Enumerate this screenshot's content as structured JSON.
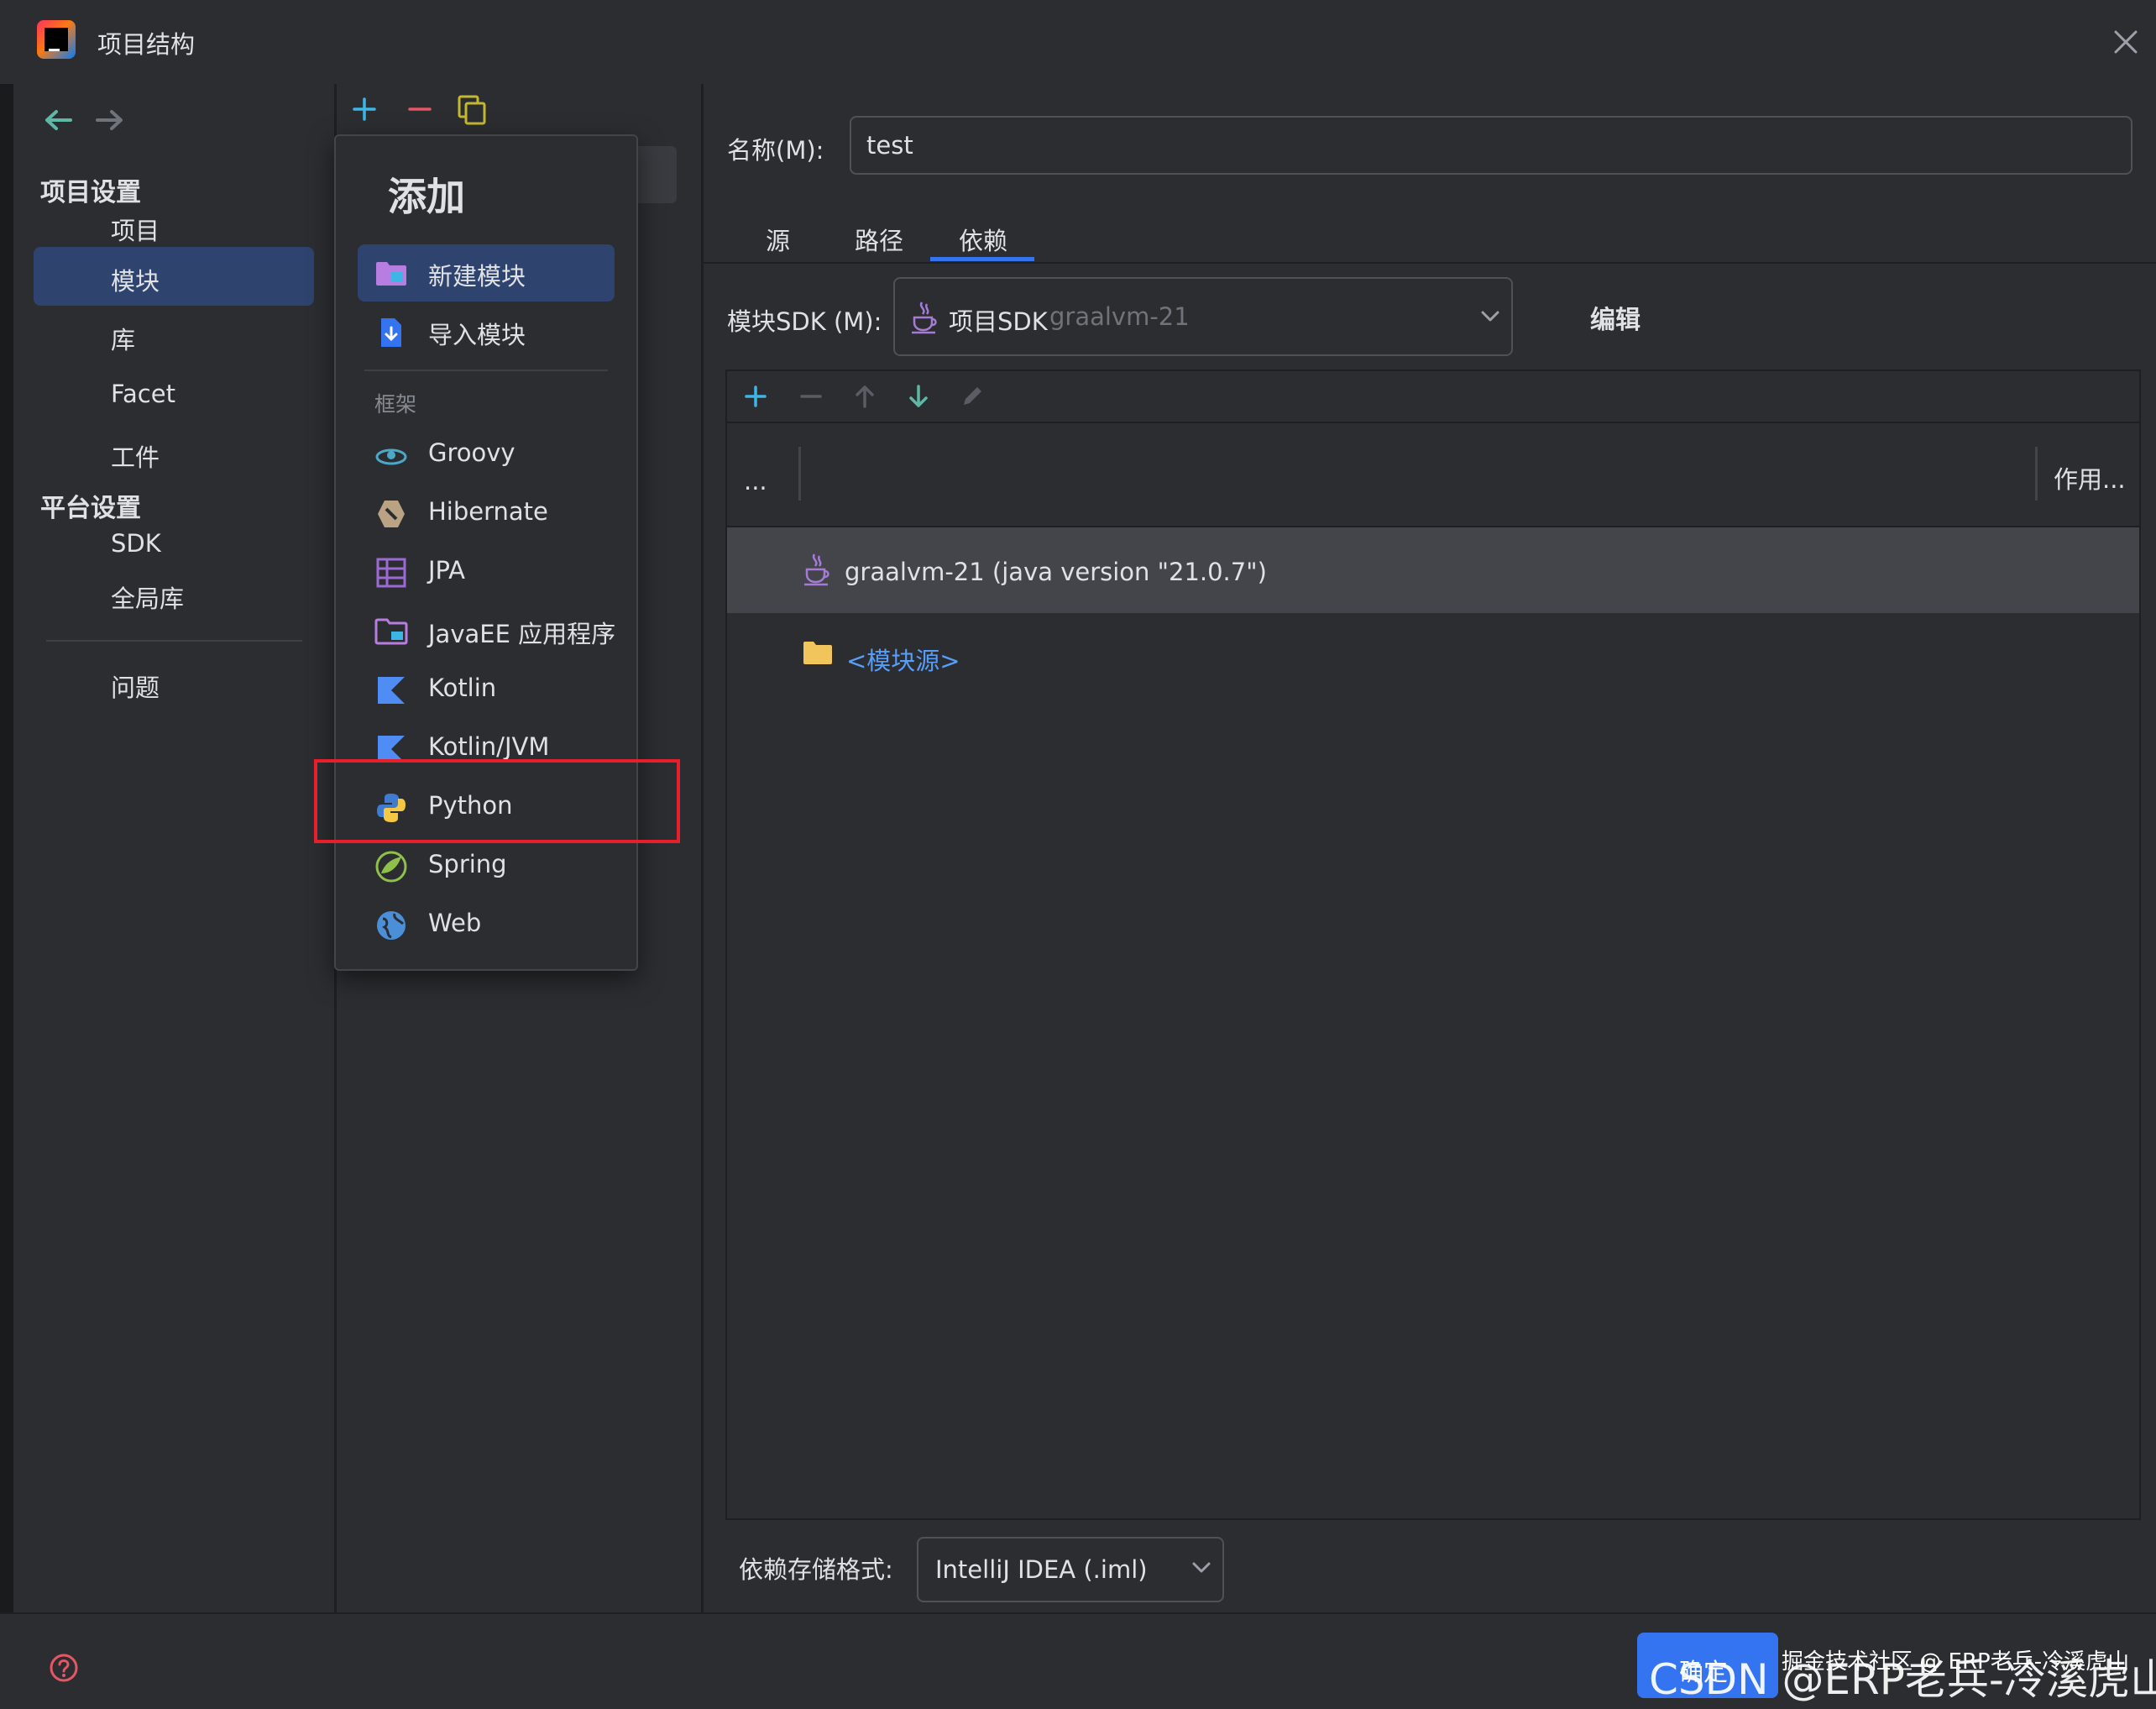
{
  "window": {
    "title": "项目结构"
  },
  "nav": {
    "project_settings": "项目设置",
    "items_project": [
      "项目",
      "模块",
      "库",
      "Facet",
      "工件"
    ],
    "platform_settings": "平台设置",
    "items_platform": [
      "SDK",
      "全局库"
    ],
    "problems": "问题"
  },
  "popup": {
    "title": "添加",
    "actions": [
      "新建模块",
      "导入模块"
    ],
    "group_label": "框架",
    "frameworks": [
      "Groovy",
      "Hibernate",
      "JPA",
      "JavaEE 应用程序",
      "Kotlin",
      "Kotlin/JVM",
      "Python",
      "Spring",
      "Web"
    ]
  },
  "content": {
    "name_label": "名称(M):",
    "name_value": "test",
    "tabs": [
      "源",
      "路径",
      "依赖"
    ],
    "active_tab": "依赖",
    "sdk_label": "模块SDK (M):",
    "sdk_prefix": "项目SDK",
    "sdk_value": "graalvm-21",
    "edit_label": "编辑",
    "dep_columns": [
      "...",
      "作用..."
    ],
    "dep_rows": [
      "graalvm-21 (java version \"21.0.7\")",
      "<模块源>"
    ],
    "storage_label": "依赖存储格式:",
    "storage_value": "IntelliJ IDEA (.iml)"
  },
  "footer": {
    "ok_label": "确定",
    "credit_small": "掘金技术社区 @ ERP老兵-冷溪虎山",
    "credit_large": "CSDN @ERP老兵-冷溪虎山"
  },
  "colors": {
    "accent": "#3574f0",
    "selection": "#2e436e",
    "highlight_box": "#e5202b",
    "link": "#589df6"
  }
}
